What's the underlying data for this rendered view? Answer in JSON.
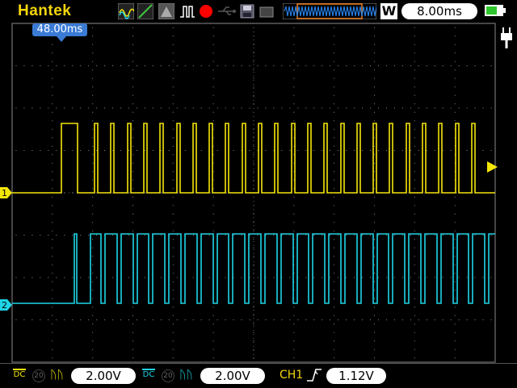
{
  "brand": "Hantek",
  "toolbar": {
    "icons": [
      "waveform-icon",
      "line-icon",
      "persistence-icon",
      "pulse-icon",
      "record-icon",
      "save-icon",
      "zoom-window-icon"
    ],
    "record_color": "#ff0000"
  },
  "timebase": "8.00ms",
  "mode": "W",
  "trigger_position": "48.00ms",
  "channels": [
    {
      "id": "1",
      "color": "#f5e60a",
      "coupling": "DC",
      "probe": "20",
      "volts": "2.00V"
    },
    {
      "id": "2",
      "color": "#1fd4e6",
      "coupling": "DC",
      "probe": "20",
      "volts": "2.00V"
    }
  ],
  "trigger": {
    "source": "CH1",
    "edge": "rising",
    "level": "1.12V"
  },
  "colors": {
    "ch1": "#f5e60a",
    "ch2": "#1fd4e6",
    "grid": "#8a8a8a",
    "accent": "#3a7bd5"
  }
}
